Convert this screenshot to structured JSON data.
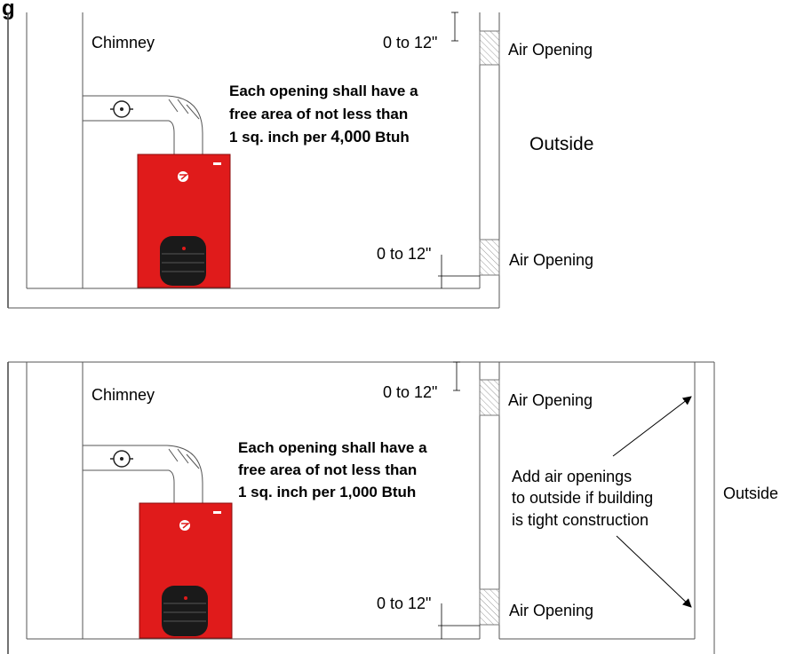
{
  "figure_heading": "g",
  "panels": [
    {
      "chimney_label": "Chimney",
      "clearance_top": "0 to 12\"",
      "clearance_bottom": "0 to 12\"",
      "air_opening_top": "Air Opening",
      "air_opening_bottom": "Air Opening",
      "outside_label": "Outside",
      "requirement_line1": "Each opening shall have a",
      "requirement_line2": "free area of not less than",
      "requirement_line3_prefix": "1 sq. inch per ",
      "requirement_value": "4,000",
      "requirement_line3_suffix": " Btuh"
    },
    {
      "chimney_label": "Chimney",
      "clearance_top": "0 to 12\"",
      "clearance_bottom": "0 to 12\"",
      "air_opening_top": "Air Opening",
      "air_opening_bottom": "Air Opening",
      "outside_label": "Outside",
      "requirement_line1": "Each opening shall have a",
      "requirement_line2": "free area of not less than",
      "requirement_line3": "1 sq. inch per 1,000 Btuh",
      "note_line1": "Add air openings",
      "note_line2": "to outside if building",
      "note_line3": "is tight construction"
    }
  ],
  "colors": {
    "boiler": "#e01b1b",
    "boiler_dark": "#8a0c0c",
    "burner": "#1a1a1a",
    "lines": "#555555",
    "hatch": "#999999"
  }
}
